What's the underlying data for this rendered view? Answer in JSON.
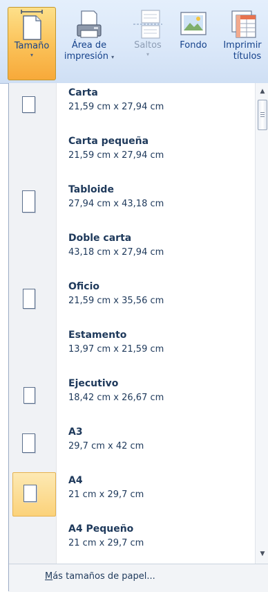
{
  "ribbon": {
    "buttons": [
      {
        "label_lines": [
          "Tamaño"
        ],
        "arrow": "▾",
        "icon": "page-size-icon",
        "active": true,
        "disabled": false
      },
      {
        "label_lines": [
          "Área de",
          "impresión"
        ],
        "arrow": "▾",
        "icon": "printer-icon",
        "active": false,
        "disabled": false
      },
      {
        "label_lines": [
          "Saltos"
        ],
        "arrow": "▾",
        "icon": "page-breaks-icon",
        "active": false,
        "disabled": true
      },
      {
        "label_lines": [
          "Fondo"
        ],
        "arrow": "",
        "icon": "background-image-icon",
        "active": false,
        "disabled": false
      },
      {
        "label_lines": [
          "Imprimir",
          "títulos"
        ],
        "arrow": "",
        "icon": "print-titles-icon",
        "active": false,
        "disabled": false
      }
    ]
  },
  "sizes": [
    {
      "name": "Carta",
      "dimensions": "21,59 cm x 27,94 cm",
      "thumbnail": true,
      "selected": false
    },
    {
      "name": "Carta pequeña",
      "dimensions": "21,59 cm x 27,94 cm",
      "thumbnail": false,
      "selected": false
    },
    {
      "name": "Tabloide",
      "dimensions": "27,94 cm x 43,18 cm",
      "thumbnail": true,
      "selected": false
    },
    {
      "name": "Doble carta",
      "dimensions": "43,18 cm x 27,94 cm",
      "thumbnail": false,
      "selected": false
    },
    {
      "name": "Oficio",
      "dimensions": "21,59 cm x 35,56 cm",
      "thumbnail": true,
      "selected": false
    },
    {
      "name": "Estamento",
      "dimensions": "13,97 cm x 21,59 cm",
      "thumbnail": false,
      "selected": false
    },
    {
      "name": "Ejecutivo",
      "dimensions": "18,42 cm x 26,67 cm",
      "thumbnail": true,
      "selected": false
    },
    {
      "name": "A3",
      "dimensions": "29,7 cm x 42 cm",
      "thumbnail": true,
      "selected": false
    },
    {
      "name": "A4",
      "dimensions": "21 cm x 29,7 cm",
      "thumbnail": true,
      "selected": true
    },
    {
      "name": "A4 Pequeño",
      "dimensions": "21 cm x 29,7 cm",
      "thumbnail": false,
      "selected": false
    }
  ],
  "footer": {
    "more_sizes_label": "Más tamaños de papel..."
  },
  "scrollbar": {
    "up_icon": "▲",
    "down_icon": "▼"
  },
  "colors": {
    "selected_bg": "#fbd27a",
    "active_button": "#fbc35a",
    "text": "#1e395b"
  }
}
